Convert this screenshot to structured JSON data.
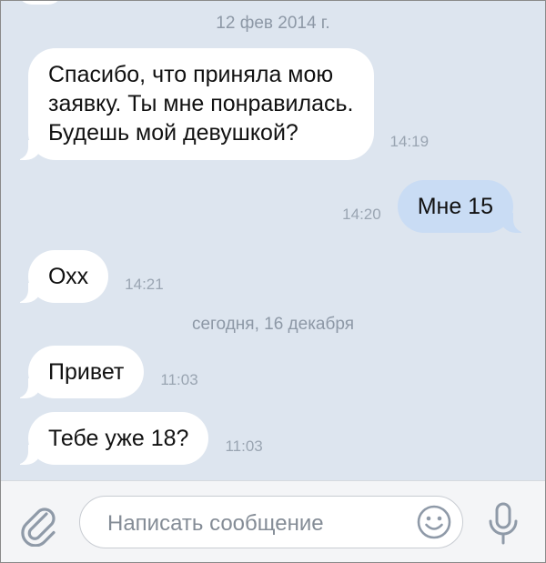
{
  "messages": [
    {
      "date": "12 фев 2014 г."
    },
    {
      "dir": "in",
      "text": "Спасибо, что приняла мою\nзаявку. Ты мне понравилась.\nБудешь мой девушкой?",
      "time": "14:19"
    },
    {
      "dir": "out",
      "text": "Мне 15",
      "time": "14:20"
    },
    {
      "dir": "in",
      "text": "Охх",
      "time": "14:21"
    },
    {
      "date": "сегодня, 16 декабря"
    },
    {
      "dir": "in",
      "text": "Привет",
      "time": "11:03"
    },
    {
      "dir": "in",
      "text": "Тебе уже 18?",
      "time": "11:03"
    }
  ],
  "input": {
    "placeholder": "Написать сообщение"
  },
  "icons": {
    "attach": "paperclip-icon",
    "emoji": "smile-icon",
    "voice": "microphone-icon"
  },
  "colors": {
    "chat_background": "#dde5ef",
    "incoming_bubble": "#ffffff",
    "outgoing_bubble": "#c9dcf4",
    "accent": "#5b8ec7",
    "meta_text": "#8d98a6"
  }
}
